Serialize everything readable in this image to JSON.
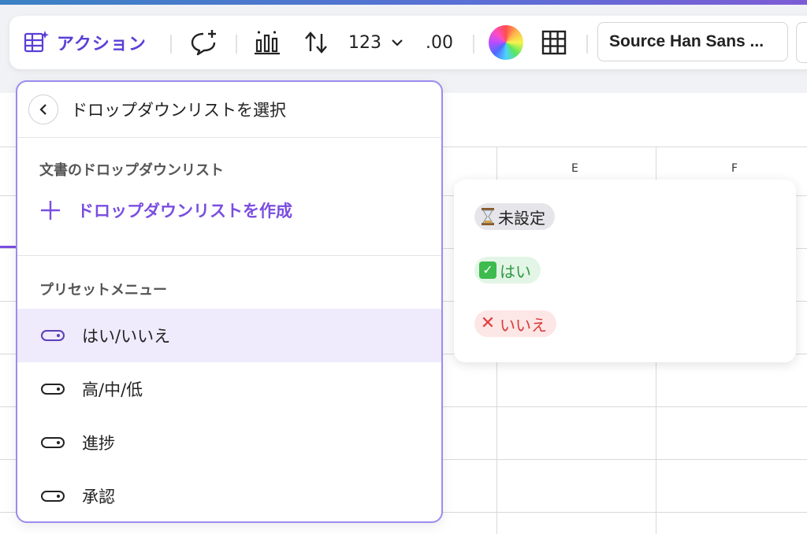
{
  "toolbar": {
    "action_label": "アクション",
    "number_format_label": "123",
    "decimal_label": ".00",
    "font_name": "Source Han Sans ..."
  },
  "sheet": {
    "columns": [
      "E",
      "F"
    ]
  },
  "panel": {
    "title": "ドロップダウンリストを選択",
    "doc_section_label": "文書のドロップダウンリスト",
    "create_label": "ドロップダウンリストを作成",
    "preset_section_label": "プリセットメニュー",
    "presets": [
      {
        "label": "はい/いいえ",
        "selected": true
      },
      {
        "label": "高/中/低",
        "selected": false
      },
      {
        "label": "進捗",
        "selected": false
      },
      {
        "label": "承認",
        "selected": false
      }
    ]
  },
  "preview": {
    "options": [
      {
        "label": "未設定",
        "icon": "hourglass-icon",
        "bg": "#e6e6ea",
        "color": "#222222"
      },
      {
        "label": "はい",
        "icon": "check-icon",
        "bg": "#e3f5e6",
        "color": "#2f9a44"
      },
      {
        "label": "いいえ",
        "icon": "cross-icon",
        "bg": "#fde6e6",
        "color": "#d83a3a"
      }
    ]
  },
  "colors": {
    "accent": "#7b4ee0",
    "panel_border": "#9a8cf0",
    "selected_bg": "#efeafc"
  }
}
